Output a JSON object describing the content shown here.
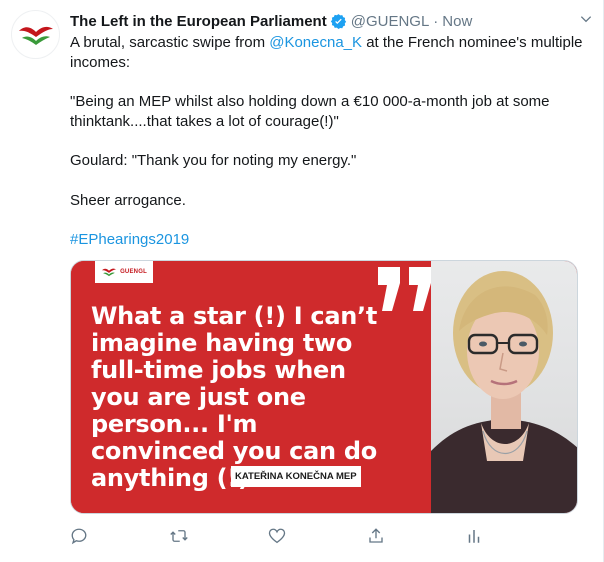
{
  "tweet": {
    "display_name": "The Left in the European Parliament",
    "handle": "@GUENGL",
    "separator": "·",
    "time": "Now",
    "text": {
      "line1_prefix": "A brutal, sarcastic swipe from ",
      "mention": "@Konecna_K",
      "line1_suffix": " at the French nominee's multiple incomes:",
      "quote": "\"Being an MEP whilst also holding down a €10 000-a-month job at some thinktank....that takes a lot of courage(!)\"",
      "reply": "Goulard: \"Thank you for noting my energy.\"",
      "closing": "Sheer arrogance.",
      "hashtag": "#EPhearings2019"
    }
  },
  "media_card": {
    "logo_text": "GUENGL",
    "quote_text": "What a star (!) I can’t imagine having two full-time jobs when you are just one person... I'm convinced you can do anything (!)",
    "name_tag": "KATEŘINA KONEČNA MEP"
  },
  "icons": {
    "avatar": "guengl-logo-icon",
    "verified": "verified-badge-icon",
    "more": "chevron-down-icon",
    "reply": "reply-icon",
    "retweet": "retweet-icon",
    "like": "heart-icon",
    "share": "share-icon",
    "analytics": "analytics-icon"
  },
  "colors": {
    "brand_red": "#cf2a2c",
    "link_blue": "#1b95e0",
    "muted_gray": "#657786"
  }
}
